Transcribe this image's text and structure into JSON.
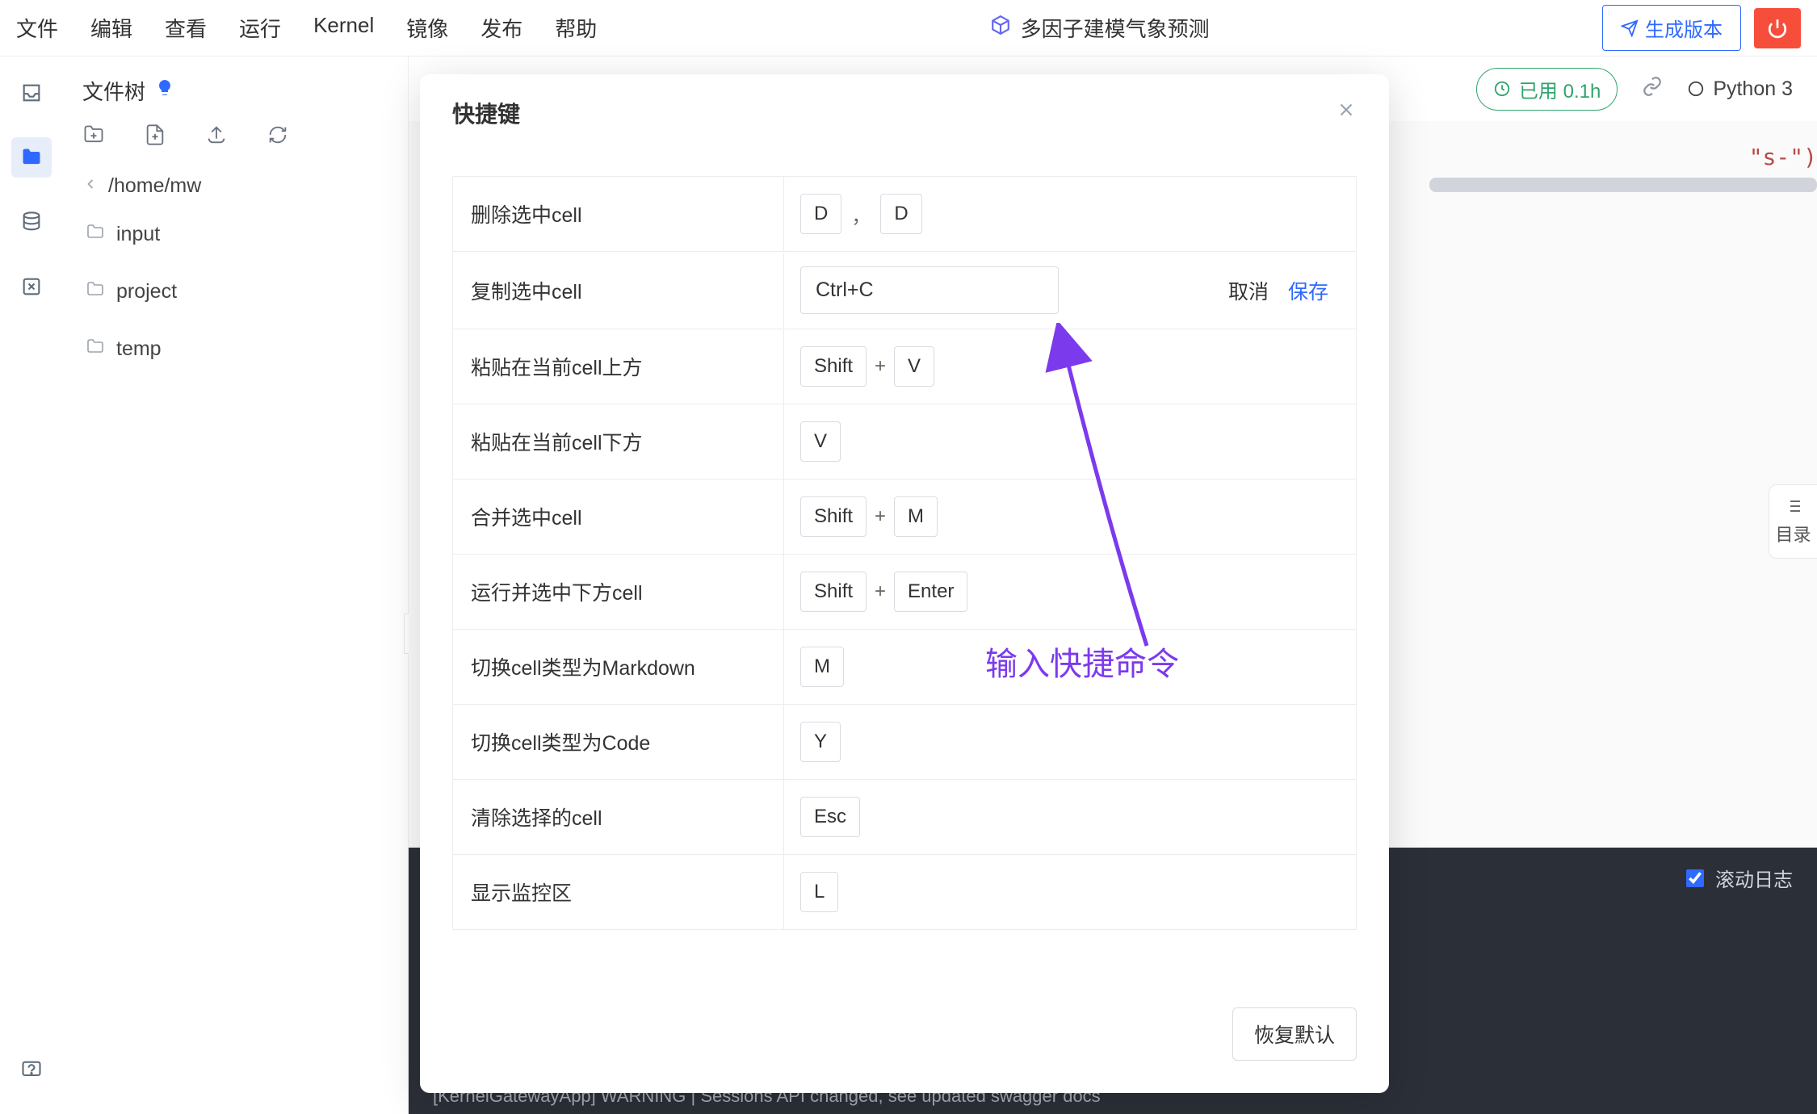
{
  "menu": {
    "items": [
      "文件",
      "编辑",
      "查看",
      "运行",
      "Kernel",
      "镜像",
      "发布",
      "帮助"
    ],
    "title": "多因子建模气象预测",
    "generate_button": "生成版本"
  },
  "sidebar": {
    "file_tree_title": "文件树",
    "path": "/home/mw",
    "folders": [
      "input",
      "project",
      "temp"
    ]
  },
  "usage": {
    "label": "已用 0.1h",
    "kernel": "Python 3"
  },
  "toc_button": "目录",
  "code_snippet": "\"s-\")",
  "log": {
    "scroll_label": "滚动日志",
    "line": "[KernelGatewayApp] WARNING | Sessions API changed, see updated swagger docs"
  },
  "modal": {
    "title": "快捷键",
    "restore_default": "恢复默认",
    "edit_cancel": "取消",
    "edit_save": "保存",
    "shortcuts": [
      {
        "label": "删除选中cell",
        "keys": [
          "D",
          ",",
          "D"
        ],
        "type": "keys"
      },
      {
        "label": "复制选中cell",
        "value": "Ctrl+C",
        "type": "input"
      },
      {
        "label": "粘贴在当前cell上方",
        "keys": [
          "Shift",
          "+",
          "V"
        ],
        "type": "keys"
      },
      {
        "label": "粘贴在当前cell下方",
        "keys": [
          "V"
        ],
        "type": "keys"
      },
      {
        "label": "合并选中cell",
        "keys": [
          "Shift",
          "+",
          "M"
        ],
        "type": "keys"
      },
      {
        "label": "运行并选中下方cell",
        "keys": [
          "Shift",
          "+",
          "Enter"
        ],
        "type": "keys"
      },
      {
        "label": "切换cell类型为Markdown",
        "keys": [
          "M"
        ],
        "type": "keys"
      },
      {
        "label": "切换cell类型为Code",
        "keys": [
          "Y"
        ],
        "type": "keys"
      },
      {
        "label": "清除选择的cell",
        "keys": [
          "Esc"
        ],
        "type": "keys"
      },
      {
        "label": "显示监控区",
        "keys": [
          "L"
        ],
        "type": "keys"
      }
    ]
  },
  "annotation": "输入快捷命令"
}
